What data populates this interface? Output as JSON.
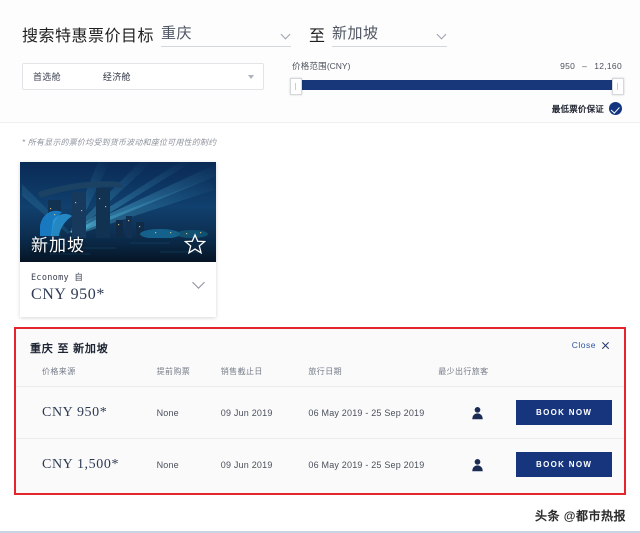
{
  "search": {
    "label": "搜索特惠票价目标",
    "origin": "重庆",
    "to_label": "至",
    "destination": "新加坡",
    "cabin_label": "首选舱",
    "cabin_value": "经济舱"
  },
  "price_range": {
    "label": "价格范围",
    "currency_note": "(CNY)",
    "min": "950",
    "dash": "–",
    "max": "12,160"
  },
  "guarantee": {
    "text": "最低票价保证"
  },
  "disclaimer": {
    "text": "* 所有显示的票价均受到货币波动和座位可用性的制约"
  },
  "destination_card": {
    "city": "新加坡",
    "cabin": "Economy 自",
    "price": "CNY 950*"
  },
  "results": {
    "route_title": "重庆 至 新加坡",
    "close_label": "Close",
    "columns": [
      "价格来源",
      "提前购票",
      "销售截止日",
      "旅行日期",
      "最少出行旅客",
      ""
    ],
    "rows": [
      {
        "price": "CNY 950*",
        "advance": "None",
        "sale_end": "09 Jun 2019",
        "travel_dates": "06 May 2019 - 25 Sep 2019",
        "pax": "1",
        "book_label": "BOOK NOW"
      },
      {
        "price": "CNY 1,500*",
        "advance": "None",
        "sale_end": "09 Jun 2019",
        "travel_dates": "06 May 2019 - 25 Sep 2019",
        "pax": "1",
        "book_label": "BOOK NOW"
      }
    ]
  },
  "watermark": {
    "text": "头条 @都市热报"
  },
  "colors": {
    "brand_navy": "#16357d",
    "accent_red": "#e4252b",
    "link_blue": "#2a57a5"
  }
}
